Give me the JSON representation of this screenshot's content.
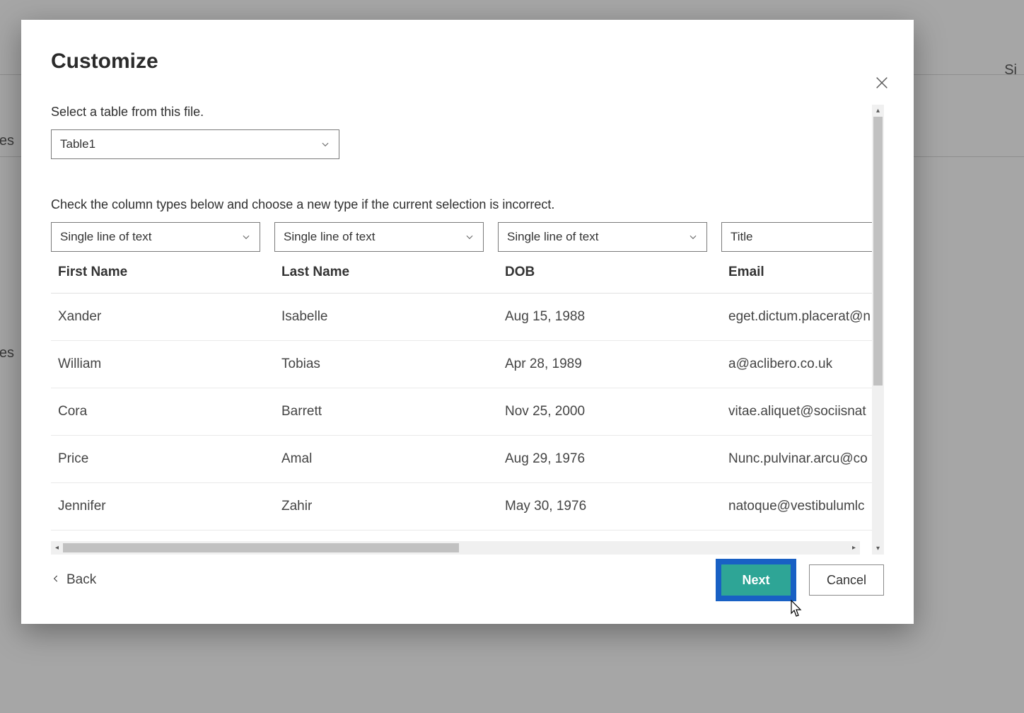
{
  "bg": {
    "frag1": "es",
    "frag2": "es",
    "frag3": "Si"
  },
  "modal": {
    "title": "Customize",
    "table_label": "Select a table from this file.",
    "table_value": "Table1",
    "types_label": "Check the column types below and choose a new type if the current selection is incorrect.",
    "col_types": [
      "Single line of text",
      "Single line of text",
      "Single line of text",
      "Title"
    ],
    "columns": [
      "First Name",
      "Last Name",
      "DOB",
      "Email"
    ],
    "rows": [
      {
        "first": "Xander",
        "last": "Isabelle",
        "dob": "Aug 15, 1988",
        "email": "eget.dictum.placerat@n"
      },
      {
        "first": "William",
        "last": "Tobias",
        "dob": "Apr 28, 1989",
        "email": "a@aclibero.co.uk"
      },
      {
        "first": "Cora",
        "last": "Barrett",
        "dob": "Nov 25, 2000",
        "email": "vitae.aliquet@sociisnat"
      },
      {
        "first": "Price",
        "last": "Amal",
        "dob": "Aug 29, 1976",
        "email": "Nunc.pulvinar.arcu@co"
      },
      {
        "first": "Jennifer",
        "last": "Zahir",
        "dob": "May 30, 1976",
        "email": "natoque@vestibulumlc"
      }
    ],
    "back_label": "Back",
    "next_label": "Next",
    "cancel_label": "Cancel"
  }
}
